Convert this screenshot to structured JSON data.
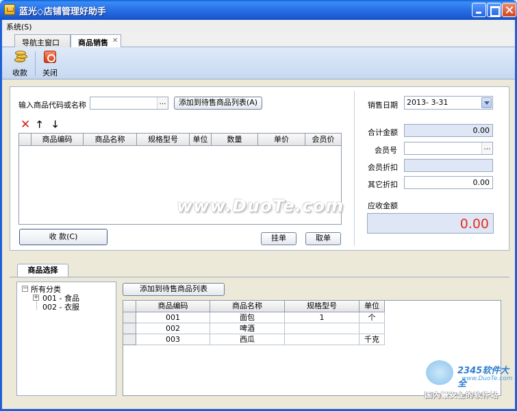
{
  "window": {
    "title": "蓝光◇店铺管理好助手"
  },
  "menu": {
    "items": [
      {
        "label": "系统(S)"
      }
    ]
  },
  "tabs": [
    {
      "label": "导航主窗口"
    },
    {
      "label": "商品销售"
    }
  ],
  "toolbar": {
    "collect_label": "收款",
    "close_label": "关闭"
  },
  "sale_panel": {
    "input_label": "输入商品代码或名称",
    "input_value": "",
    "add_button": "添加到待售商品列表(A)",
    "columns": [
      "商品编码",
      "商品名称",
      "规格型号",
      "单位",
      "数量",
      "单价",
      "会员价"
    ],
    "rows": [],
    "collect_button": "收  款(C)",
    "hold_button": "挂单",
    "cancel_button": "取单"
  },
  "summary": {
    "date_label": "销售日期",
    "date_value": "2013- 3-31",
    "total_label": "合计金额",
    "total_value": "0.00",
    "member_label": "会员号",
    "member_value": "",
    "member_discount_label": "会员折扣",
    "member_discount_value": "",
    "other_discount_label": "其它折扣",
    "other_discount_value": "0.00",
    "receivable_label": "应收金额",
    "receivable_value": "0.00"
  },
  "watermark": "www.DuoTe.com",
  "product_select": {
    "tab_label": "商品选择",
    "tree": {
      "root": "所有分类",
      "children": [
        "001 - 食品",
        "002 - 衣服"
      ]
    },
    "add_button": "添加到待售商品列表",
    "columns": [
      "商品编码",
      "商品名称",
      "规格型号",
      "单位"
    ],
    "rows": [
      {
        "code": "001",
        "name": "面包",
        "spec": "1",
        "unit": "个"
      },
      {
        "code": "002",
        "name": "啤酒",
        "spec": "",
        "unit": ""
      },
      {
        "code": "003",
        "name": "西瓜",
        "spec": "",
        "unit": "千克"
      }
    ]
  },
  "brand": {
    "name": "2345软件大全",
    "site": "www.DuoTe.com",
    "slogan": "国内最安全的软件站"
  },
  "icons": {
    "app": "shop-icon",
    "collect": "coins-icon",
    "close": "power-icon",
    "delete": "delete-x-icon",
    "up": "arrow-up-icon",
    "down": "arrow-down-icon"
  },
  "colors": {
    "titlebar": "#2a73e8",
    "amount_red": "#e0301e",
    "delete_red": "#d4201a"
  }
}
